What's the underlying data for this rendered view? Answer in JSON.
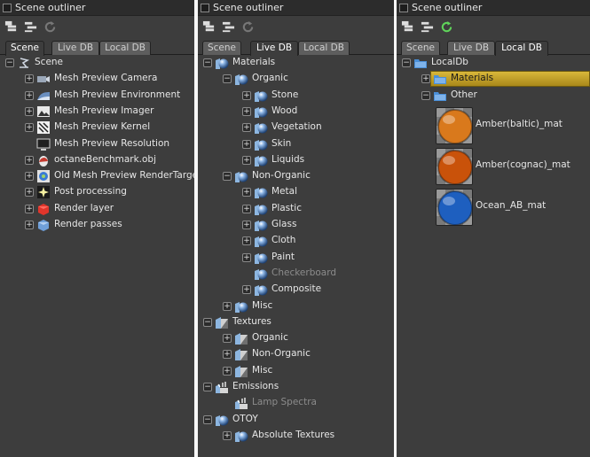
{
  "panels": [
    {
      "title": "Scene outliner",
      "tabs": [
        {
          "label": "Scene",
          "active": true
        },
        {
          "label": "Live DB",
          "active": false
        },
        {
          "label": "Local DB",
          "active": false
        }
      ],
      "toolbar": [
        {
          "icon": "expand-tree-icon"
        },
        {
          "icon": "collapse-tree-icon"
        },
        {
          "icon": "refresh-icon",
          "state": "disabled"
        }
      ],
      "rows": [
        {
          "label": "Scene",
          "icon": "scene-icon",
          "toggle": "-",
          "level": 0
        },
        {
          "label": "Mesh Preview Camera",
          "icon": "camera-icon",
          "toggle": "+",
          "level": 1
        },
        {
          "label": "Mesh Preview Environment",
          "icon": "environment-icon",
          "toggle": "+",
          "level": 1
        },
        {
          "label": "Mesh Preview Imager",
          "icon": "imager-icon",
          "toggle": "+",
          "level": 1
        },
        {
          "label": "Mesh Preview Kernel",
          "icon": "kernel-icon",
          "toggle": "+",
          "level": 1
        },
        {
          "label": "Mesh Preview Resolution",
          "icon": "resolution-icon",
          "toggle": "",
          "level": 1
        },
        {
          "label": "octaneBenchmark.obj",
          "icon": "mesh-icon",
          "toggle": "+",
          "level": 1
        },
        {
          "label": "Old Mesh Preview RenderTarget",
          "icon": "render-target-icon",
          "toggle": "+",
          "level": 1
        },
        {
          "label": "Post processing",
          "icon": "post-processing-icon",
          "toggle": "+",
          "level": 1
        },
        {
          "label": "Render layer",
          "icon": "render-layer-icon",
          "toggle": "+",
          "level": 1
        },
        {
          "label": "Render passes",
          "icon": "render-passes-icon",
          "toggle": "+",
          "level": 1
        }
      ]
    },
    {
      "title": "Scene outliner",
      "tabs": [
        {
          "label": "Scene",
          "active": false
        },
        {
          "label": "Live DB",
          "active": true
        },
        {
          "label": "Local DB",
          "active": false
        }
      ],
      "toolbar": [
        {
          "icon": "expand-tree-icon"
        },
        {
          "icon": "collapse-tree-icon"
        },
        {
          "icon": "refresh-icon",
          "state": "disabled"
        }
      ],
      "rows": [
        {
          "label": "Materials",
          "icon": "material-category-icon",
          "toggle": "-",
          "level": 0
        },
        {
          "label": "Organic",
          "icon": "material-category-icon",
          "toggle": "-",
          "level": 1
        },
        {
          "label": "Stone",
          "icon": "material-category-icon",
          "toggle": "+",
          "level": 2
        },
        {
          "label": "Wood",
          "icon": "material-category-icon",
          "toggle": "+",
          "level": 2
        },
        {
          "label": "Vegetation",
          "icon": "material-category-icon",
          "toggle": "+",
          "level": 2
        },
        {
          "label": "Skin",
          "icon": "material-category-icon",
          "toggle": "+",
          "level": 2
        },
        {
          "label": "Liquids",
          "icon": "material-category-icon",
          "toggle": "+",
          "level": 2
        },
        {
          "label": "Non-Organic",
          "icon": "material-category-icon",
          "toggle": "-",
          "level": 1
        },
        {
          "label": "Metal",
          "icon": "material-category-icon",
          "toggle": "+",
          "level": 2
        },
        {
          "label": "Plastic",
          "icon": "material-category-icon",
          "toggle": "+",
          "level": 2
        },
        {
          "label": "Glass",
          "icon": "material-category-icon",
          "toggle": "+",
          "level": 2
        },
        {
          "label": "Cloth",
          "icon": "material-category-icon",
          "toggle": "+",
          "level": 2
        },
        {
          "label": "Paint",
          "icon": "material-category-icon",
          "toggle": "+",
          "level": 2
        },
        {
          "label": "Checkerboard",
          "icon": "material-category-icon",
          "toggle": "",
          "level": 2,
          "dim": true
        },
        {
          "label": "Composite",
          "icon": "material-category-icon",
          "toggle": "+",
          "level": 2
        },
        {
          "label": "Misc",
          "icon": "material-category-icon",
          "toggle": "+",
          "level": 1
        },
        {
          "label": "Textures",
          "icon": "texture-category-icon",
          "toggle": "-",
          "level": 0
        },
        {
          "label": "Organic",
          "icon": "texture-category-icon",
          "toggle": "+",
          "level": 1
        },
        {
          "label": "Non-Organic",
          "icon": "texture-category-icon",
          "toggle": "+",
          "level": 1
        },
        {
          "label": "Misc",
          "icon": "texture-category-icon",
          "toggle": "+",
          "level": 1
        },
        {
          "label": "Emissions",
          "icon": "emission-category-icon",
          "toggle": "-",
          "level": 0
        },
        {
          "label": "Lamp Spectra",
          "icon": "emission-category-icon",
          "toggle": "",
          "level": 1,
          "dim": true
        },
        {
          "label": "OTOY",
          "icon": "material-category-icon",
          "toggle": "-",
          "level": 0
        },
        {
          "label": "Absolute Textures",
          "icon": "material-category-icon",
          "toggle": "+",
          "level": 1
        }
      ]
    },
    {
      "title": "Scene outliner",
      "tabs": [
        {
          "label": "Scene",
          "active": false
        },
        {
          "label": "Live DB",
          "active": false
        },
        {
          "label": "Local DB",
          "active": true
        }
      ],
      "toolbar": [
        {
          "icon": "expand-tree-icon"
        },
        {
          "icon": "collapse-tree-icon"
        },
        {
          "icon": "refresh-icon",
          "state": "enabled"
        }
      ],
      "rows": [
        {
          "label": "LocalDb",
          "icon": "folder-icon",
          "toggle": "-",
          "level": 0
        },
        {
          "label": "Materials",
          "icon": "folder-icon",
          "toggle": "+",
          "level": 1,
          "selected": true
        },
        {
          "label": "Other",
          "icon": "folder-icon",
          "toggle": "-",
          "level": 1
        }
      ],
      "materials": [
        {
          "label": "Amber(baltic)_mat",
          "swatch": "#d9791c"
        },
        {
          "label": "Amber(cognac)_mat",
          "swatch": "#c9520a"
        },
        {
          "label": "Ocean_AB_mat",
          "swatch": "#1e5fbf"
        }
      ]
    }
  ],
  "colors": {
    "panel_bg": "#3d3d3d",
    "selection": "#c9a42a",
    "refresh_enabled": "#5fd35a"
  }
}
